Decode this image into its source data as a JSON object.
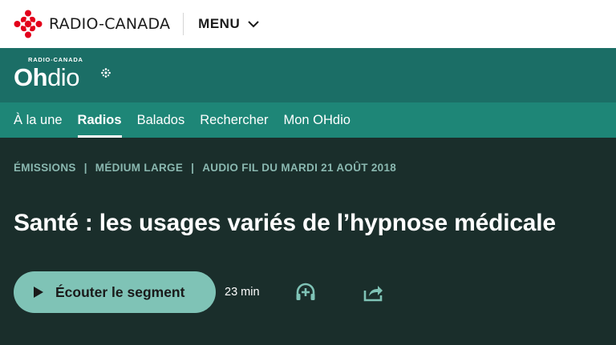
{
  "topbar": {
    "brand": "RADIO-CANADA",
    "menu_label": "MENU"
  },
  "ohdio": {
    "small_label": "RADIO-CANADA",
    "brand_bold": "Oh",
    "brand_regular": "dio"
  },
  "nav": {
    "items": [
      {
        "label": "À la une",
        "active": false
      },
      {
        "label": "Radios",
        "active": true
      },
      {
        "label": "Balados",
        "active": false
      },
      {
        "label": "Rechercher",
        "active": false
      },
      {
        "label": "Mon OHdio",
        "active": false
      }
    ]
  },
  "breadcrumb": {
    "items": [
      "ÉMISSIONS",
      "MÉDIUM LARGE",
      "AUDIO FIL DU MARDI 21 AOÛT 2018"
    ],
    "separator": "|"
  },
  "episode": {
    "title": "Santé : les usages variés de l’hypnose médicale",
    "listen_label": "Écouter le segment",
    "duration": "23 min"
  },
  "icons": {
    "logo": "radio-canada-gem-icon",
    "menu": "chevron-down-icon",
    "play": "play-icon",
    "listen_later": "headphones-plus-icon",
    "share": "share-icon"
  },
  "colors": {
    "brand_red": "#e3001b",
    "ohdio_band": "#1b6e66",
    "nav_band": "#1e8677",
    "main_bg": "#1a2e2b",
    "accent": "#7fc3b6",
    "breadcrumb": "#8ab8b0"
  }
}
